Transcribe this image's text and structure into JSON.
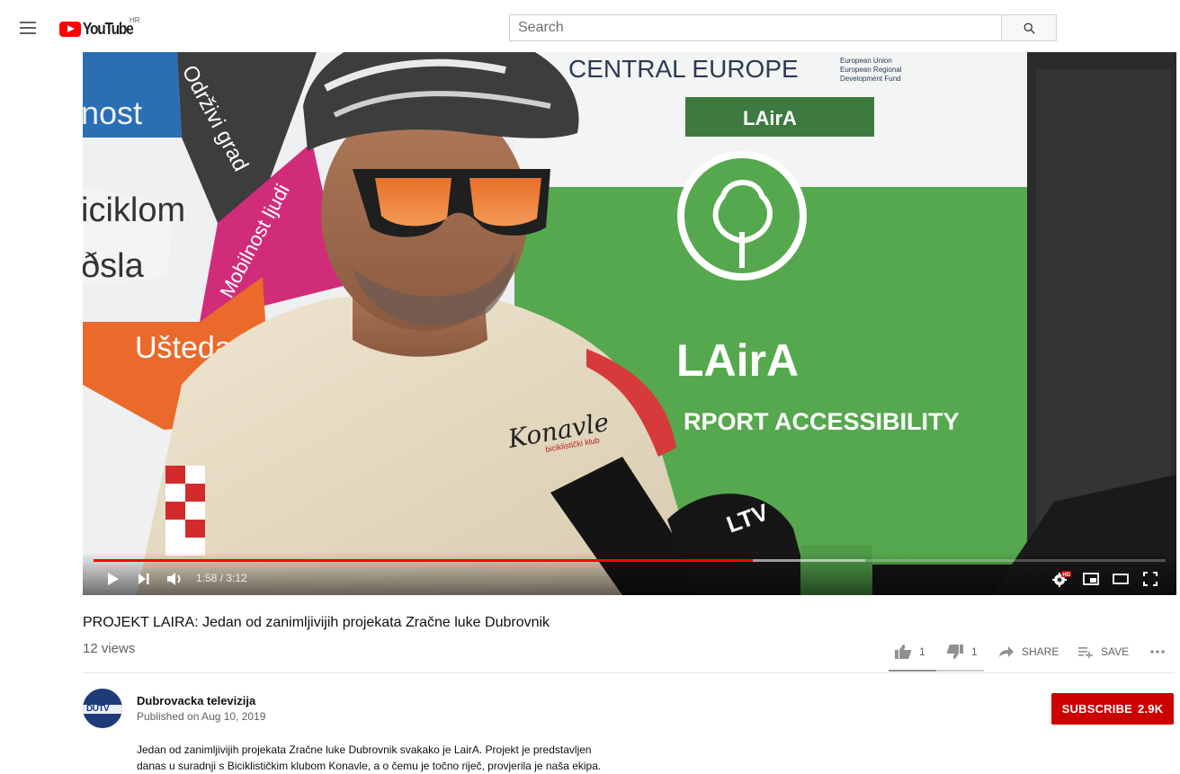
{
  "masthead": {
    "logo_text": "YouTube",
    "region": "HR",
    "search_placeholder": "Search"
  },
  "player": {
    "current_time": "1:58",
    "duration": "3:12",
    "time_display": "1:58 / 3:12",
    "played_fraction": 0.615,
    "loaded_fraction": 0.72,
    "scene_text": {
      "header": "CENTRAL EUROPE",
      "eu_line1": "European Union",
      "eu_line2": "European Regional",
      "eu_line3": "Development Fund",
      "banner_tag": "LAirA",
      "big_title": "LAirA",
      "subtitle": "RPORT ACCESSIBILITY",
      "left_words": [
        "nost",
        "Održivi grad",
        "iciklom",
        "Mobilnost ljudi",
        "ðsla",
        "Ušteda"
      ],
      "jersey_text": "Konavle",
      "jersey_sub": "biciklistički klub",
      "mic_logo": "LTV"
    },
    "accent_colors": {
      "progress": "#ff0000",
      "banner_green": "#55a84e"
    }
  },
  "video": {
    "title": "PROJEKT LAIRA: Jedan od zanimljivijih projekata Zračne luke Dubrovnik",
    "views": "12 views",
    "likes": "1",
    "dislikes": "1",
    "share_label": "SHARE",
    "save_label": "SAVE",
    "like_ratio": 0.5
  },
  "channel": {
    "avatar_text": "DUTV",
    "name": "Dubrovacka televizija",
    "published": "Published on Aug 10, 2019",
    "subscribe_label": "SUBSCRIBE",
    "subscriber_count": "2.9K"
  },
  "description": {
    "line1": "Jedan od zanimljivijih projekata Zračne luke Dubrovnik svakako je LairA. Projekt je predstavljen",
    "line2": "danas u suradnji s Biciklističkim klubom Konavle, a o čemu je točno riječ, provjerila je naša ekipa."
  }
}
